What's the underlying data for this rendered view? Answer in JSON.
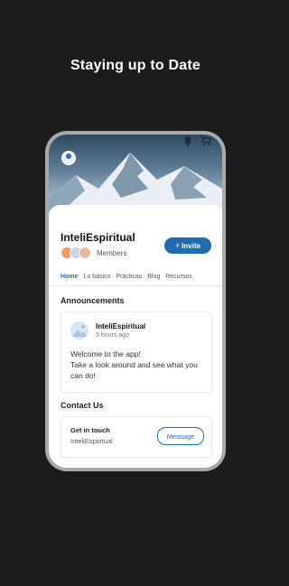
{
  "headline": "Staying up to Date",
  "header": {
    "avatar_icon": "profile-avatar-icon",
    "icons": [
      "bell-icon",
      "cart-icon"
    ]
  },
  "group": {
    "name": "InteliEspiritual",
    "members_label": "Members",
    "invite_label": "Invite",
    "invite_icon": "plus-icon"
  },
  "tabs": [
    {
      "label": "Home",
      "active": true
    },
    {
      "label": "Lo básico",
      "active": false
    },
    {
      "label": "Prácticas",
      "active": false
    },
    {
      "label": "Blog",
      "active": false
    },
    {
      "label": "Recursos",
      "active": false
    }
  ],
  "announcements": {
    "title": "Announcements",
    "post": {
      "author": "InteliEspiritual",
      "time": "3 hours ago",
      "line1": "Welcome to the app!",
      "line2": "Take a look around and see what you can do!"
    }
  },
  "contact": {
    "title": "Contact Us",
    "card_title": "Get in touch",
    "card_sub": "InteliEspiritual",
    "button": "Message"
  },
  "colors": {
    "accent": "#1f6eb0",
    "background": "#1c1c1c"
  }
}
